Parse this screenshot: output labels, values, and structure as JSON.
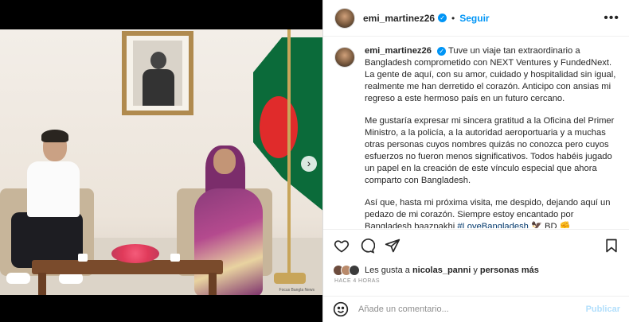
{
  "post": {
    "image_credit": "Focus Bangla News",
    "next_button": "›"
  },
  "header": {
    "username": "emi_martinez26",
    "separator": "•",
    "follow_label": "Seguir",
    "more_label": "•••"
  },
  "caption": {
    "username": "emi_martinez26",
    "paragraph1": "Tuve un viaje tan extraordinario a Bangladesh comprometido con NEXT Ventures y FundedNext. La gente de aquí, con su amor, cuidado y hospitalidad sin igual, realmente me han derretido el corazón. Anticipo con ansias mi regreso a este hermoso país en un futuro cercano.",
    "paragraph2": "Me gustaría expresar mi sincera gratitud a la Oficina del Primer Ministro, a la policía, a la autoridad aeroportuaria y a muchas otras personas cuyos nombres quizás no conozca pero cuyos esfuerzos no fueron menos significativos. Todos habéis jugado un papel en la creación de este vínculo especial que ahora comparto con Bangladesh.",
    "paragraph3_text": "Así que, hasta mi próxima visita, me despido, dejando aquí un pedazo de mi corazón. Siempre estoy encantado por Bangladesh baazpakhi ",
    "hashtag": "#LoveBangladesh",
    "emoji_tail": " 🦅 BD ✊"
  },
  "likes": {
    "prefix": "Les gusta a ",
    "user": "nicolas_panni",
    "middle": " y ",
    "others": "personas más"
  },
  "timestamp": "HACE 4 HORAS",
  "comment": {
    "placeholder": "Añade un comentario...",
    "post_label": "Publicar"
  },
  "icons": {
    "like": "heart-icon",
    "comment": "comment-icon",
    "share": "share-icon",
    "save": "bookmark-icon",
    "emoji": "emoji-icon"
  },
  "colors": {
    "link": "#0095f6",
    "hashtag": "#00376b",
    "muted": "#8e8e8e",
    "post_disabled": "#b2dffc"
  }
}
